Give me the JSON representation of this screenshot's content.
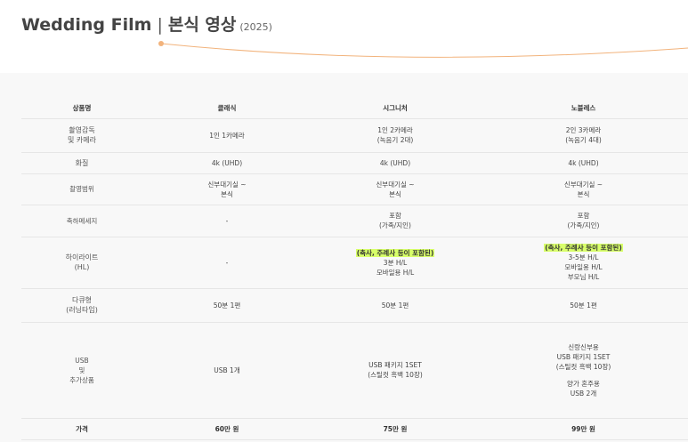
{
  "page": {
    "title": "Wedding Film",
    "separator": "|",
    "subtitle": "본식 영상",
    "year": "(2025)"
  },
  "theme": {
    "accent": "#f2b37c",
    "panel_bg": "#f8f8f8",
    "highlight": "#d8ff6a"
  },
  "table": {
    "headers": [
      "상품명",
      "클래식",
      "시그니처",
      "노블레스"
    ],
    "rows": [
      {
        "label": [
          "촬영감독",
          "및 카메라"
        ],
        "cells": [
          [
            "1인 1카메라"
          ],
          [
            "1인 2카메라",
            "(녹음기 2대)"
          ],
          [
            "2인 3카메라",
            "(녹음기 4대)"
          ]
        ]
      },
      {
        "label": [
          "화질"
        ],
        "cells": [
          [
            "4k (UHD)"
          ],
          [
            "4k (UHD)"
          ],
          [
            "4k (UHD)"
          ]
        ]
      },
      {
        "label": [
          "촬영범위"
        ],
        "cells": [
          [
            "신부대기실 ~",
            "본식"
          ],
          [
            "신부대기실 ~",
            "본식"
          ],
          [
            "신부대기실 ~",
            "본식"
          ]
        ]
      },
      {
        "label": [
          "축하메세지"
        ],
        "cells": [
          [
            "-"
          ],
          [
            "포함",
            "(가족/지인)"
          ],
          [
            "포함",
            "(가족/지인)"
          ]
        ]
      },
      {
        "label": [
          "하이라이트",
          "(HL)"
        ],
        "highlight_note": "(축사, 주례사 등이 포함된)",
        "cells": [
          [
            "-"
          ],
          [
            "3분 H/L",
            "모바일용 H/L"
          ],
          [
            "3-5분 H/L",
            "모바일용 H/L",
            "부모님 H/L"
          ]
        ]
      },
      {
        "label": [
          "다큐형",
          "(러닝타임)"
        ],
        "cells": [
          [
            "50분 1편"
          ],
          [
            "50분 1편"
          ],
          [
            "50분 1편"
          ]
        ]
      },
      {
        "label": [
          "USB",
          "및",
          "추가상품"
        ],
        "cells": [
          [
            "USB 1개"
          ],
          [
            "USB 패키지 1SET",
            "(스틸컷 흑백 10장)"
          ],
          [
            "신랑신부용",
            "USB 패키지 1SET",
            "(스틸컷 흑백 10장)",
            "",
            "양가 혼주용",
            "USB 2개"
          ]
        ]
      },
      {
        "label": [
          "가격"
        ],
        "cells": [
          [
            "60만 원"
          ],
          [
            "75만 원"
          ],
          [
            "99만 원"
          ]
        ]
      }
    ]
  }
}
